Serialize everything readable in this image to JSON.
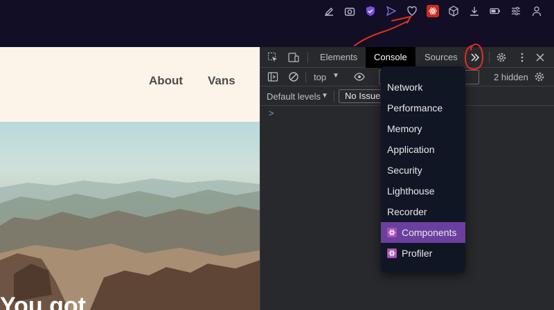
{
  "browser": {
    "toolbar_icons": [
      "edit-icon",
      "camera-icon",
      "shield-icon",
      "send-icon",
      "heart-icon",
      "react-devtools-icon",
      "cube-icon",
      "download-icon",
      "battery-icon",
      "sliders-icon",
      "user-icon"
    ]
  },
  "page": {
    "nav": {
      "about": "About",
      "vans": "Vans"
    },
    "hero_text": "You got"
  },
  "devtools": {
    "tabs": {
      "elements": "Elements",
      "console": "Console",
      "sources": "Sources"
    },
    "context_select": "top",
    "hidden_count": "2 hidden",
    "levels": "Default levels",
    "issues_button": "No Issues",
    "prompt": ">"
  },
  "menu": {
    "items": [
      "Network",
      "Performance",
      "Memory",
      "Application",
      "Security",
      "Lighthouse",
      "Recorder",
      "Components",
      "Profiler"
    ],
    "selected": "Components"
  },
  "colors": {
    "accent_purple": "#6b3fa0",
    "annotation_red": "#e0301e",
    "toolbar_bg": "#120e26"
  }
}
